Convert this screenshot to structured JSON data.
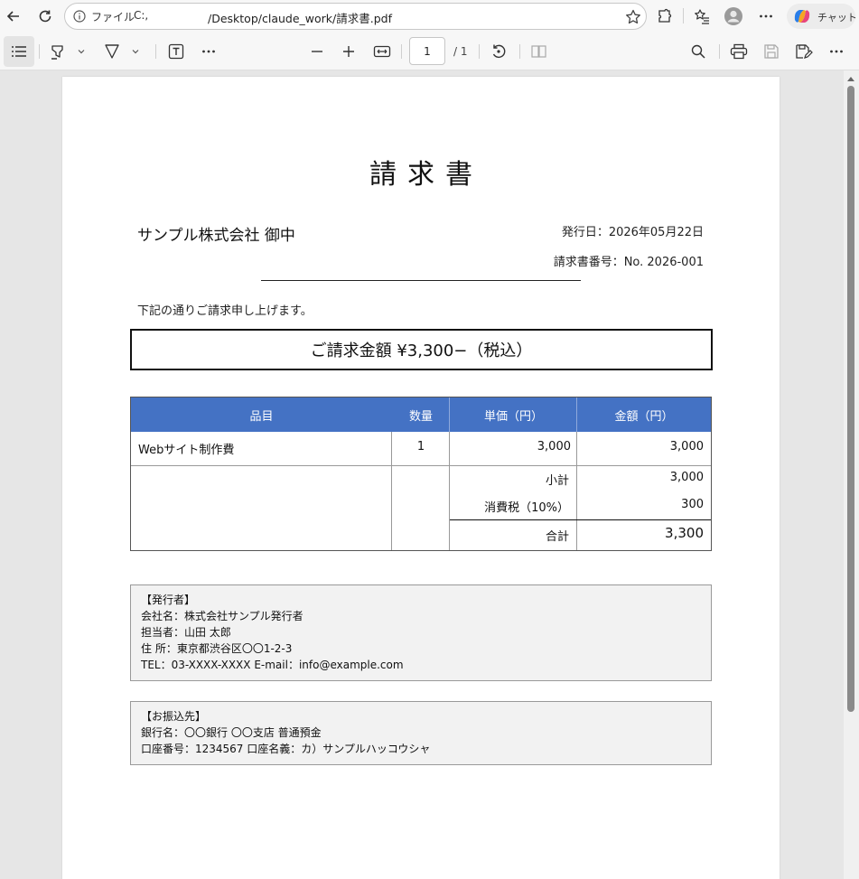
{
  "browser": {
    "url_label": "ファイル",
    "url_drive": "C:,",
    "url_path": "/Desktop/claude_work/請求書.pdf",
    "copilot_label": "チャット"
  },
  "pdf_toolbar": {
    "page_number": "1",
    "page_total": "/ 1"
  },
  "document": {
    "title": "請求書",
    "client": "サンプル株式会社 御中",
    "issue_date": "発行日：2026年05月22日",
    "invoice_no": "請求書番号：No. 2026-001",
    "intro": "下記の通りご請求申し上げます。",
    "amount": "ご請求金額 ¥3,300−（税込）",
    "table": {
      "headers": [
        "品目",
        "数量",
        "単価（円）",
        "金額（円）"
      ],
      "rows": [
        {
          "item": "Webサイト制作費",
          "qty": "1",
          "unit_price": "3,000",
          "amount": "3,000"
        }
      ],
      "summary": [
        {
          "label": "小計",
          "value": "3,000"
        },
        {
          "label": "消費税（10%）",
          "value": "300"
        },
        {
          "label": "合計",
          "value": "3,300"
        }
      ]
    },
    "issuer": {
      "lines": [
        "【発行者】",
        "会社名：株式会社サンプル発行者",
        "担当者：山田 太郎",
        "住 所：東京都渋谷区〇〇1-2-3",
        "TEL：03-XXXX-XXXX E-mail：info@example.com"
      ]
    },
    "bank": {
      "lines": [
        "【お振込先】",
        "銀行名：〇〇銀行 〇〇支店 普通預金",
        "口座番号：1234567 口座名義：カ）サンプルハッコウシャ"
      ]
    }
  },
  "colors": {
    "table_header": "#4472c4",
    "info_background": "#f2f2f2"
  }
}
